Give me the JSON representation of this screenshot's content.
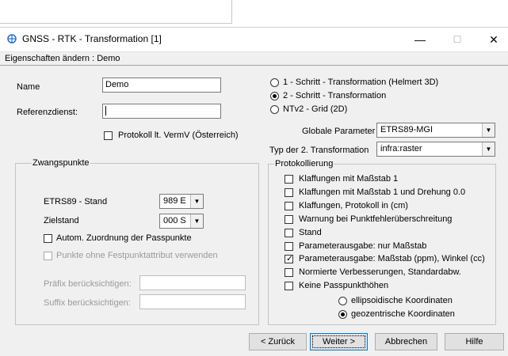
{
  "window": {
    "title": "GNSS - RTK - Transformation [1]",
    "minimize": "—",
    "maximize": "☐",
    "close": "✕",
    "subheader": "Eigenschaften ändern : Demo"
  },
  "form": {
    "name_label": "Name",
    "name_value": "Demo",
    "ref_label": "Referenzdienst:",
    "ref_value": "",
    "protokoll_label": "Protokoll lt. VermV (Österreich)",
    "protokoll_checked": false
  },
  "transform_options": [
    {
      "label": "1 - Schritt - Transformation (Helmert 3D)",
      "selected": false
    },
    {
      "label": "2 - Schritt - Transformation",
      "selected": true
    },
    {
      "label": "NTv2 - Grid (2D)",
      "selected": false
    }
  ],
  "globale_parameter": {
    "label": "Globale Parameter",
    "value": "ETRS89-MGI"
  },
  "typ_transformation": {
    "label": "Typ der 2. Transformation",
    "value": "infra:raster"
  },
  "zwangspunkte": {
    "title": "Zwangspunkte",
    "etrs_label": "ETRS89 - Stand",
    "etrs_value": "989  E",
    "ziel_label": "Zielstand",
    "ziel_value": "000  S",
    "autom_label": "Autom. Zuordnung der Passpunkte",
    "autom_checked": false,
    "punkte_label": "Punkte ohne Festpunktattribut verwenden",
    "punkte_checked": false,
    "praefix_label": "Präfix berücksichtigen:",
    "praefix_value": "",
    "suffix_label": "Suffix berücksichtigen:",
    "suffix_value": ""
  },
  "protokollierung": {
    "title": "Protokollierung",
    "items": [
      {
        "label": "Klaffungen mit Maßstab 1",
        "checked": false
      },
      {
        "label": "Klaffungen mit Maßstab 1 und Drehung 0.0",
        "checked": false
      },
      {
        "label": "Klaffungen, Protokoll in (cm)",
        "checked": false
      },
      {
        "label": "Warnung bei Punktfehlerüberschreitung",
        "checked": false
      },
      {
        "label": "Stand",
        "checked": false
      },
      {
        "label": "Parameterausgabe: nur Maßstab",
        "checked": false
      },
      {
        "label": "Parameterausgabe: Maßstab (ppm), Winkel (cc)",
        "checked": true
      },
      {
        "label": "Normierte Verbesserungen, Standardabw.",
        "checked": false
      },
      {
        "label": "Keine Passpunkthöhen",
        "checked": false
      }
    ],
    "coord_options": [
      {
        "label": "ellipsoidische Koordinaten",
        "selected": false
      },
      {
        "label": "geozentrische Koordinaten",
        "selected": true
      }
    ]
  },
  "buttons": {
    "back": "< Zurück",
    "next": "Weiter >",
    "cancel": "Abbrechen",
    "help": "Hilfe"
  },
  "colors": {
    "window_bg": "#f0f0f0",
    "accent": "#0078d7",
    "icon": "#1e6fd9"
  }
}
